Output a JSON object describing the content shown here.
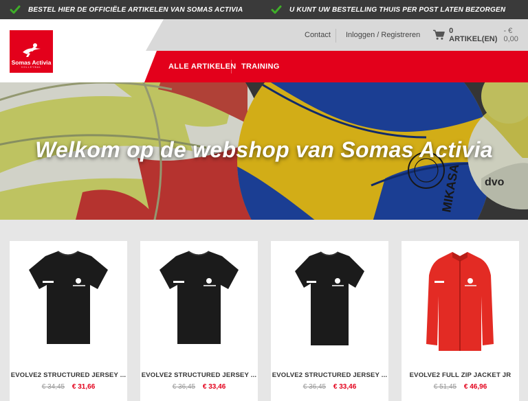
{
  "topbar": {
    "usp_left": "BESTEL HIER DE OFFICIËLE ARTIKELEN VAN SOMAS ACTIVIA",
    "usp_right": "U KUNT UW BESTELLING THUIS PER POST LATEN BEZORGEN",
    "check_icon": "check-icon",
    "check_color": "#3fae29"
  },
  "header": {
    "logo": {
      "name": "Somas Activia",
      "sub": "VOLLEYBAL",
      "color": "#e3001b"
    },
    "utility": {
      "contact": "Contact",
      "login": "Inloggen / Registreren",
      "cart_count": "0 ARTIKEL(EN)",
      "cart_total": "- € 0,00",
      "cart_icon": "cart-icon"
    },
    "nav": {
      "items": [
        "ALLE ARTIKELEN",
        "TRAINING"
      ],
      "accent": "#e3001b"
    }
  },
  "hero": {
    "title": "Welkom op de webshop van Somas Activia"
  },
  "products": [
    {
      "name": "EVOLVE2 STRUCTURED JERSEY ...",
      "old_price": "€ 34,45",
      "price": "€ 31,66",
      "image": "black-tshirt"
    },
    {
      "name": "EVOLVE2 STRUCTURED JERSEY ...",
      "old_price": "€ 36,45",
      "price": "€ 33,46",
      "image": "black-tshirt"
    },
    {
      "name": "EVOLVE2 STRUCTURED JERSEY ...",
      "old_price": "€ 36,45",
      "price": "€ 33,46",
      "image": "black-tshirt"
    },
    {
      "name": "EVOLVE2 FULL ZIP JACKET JR",
      "old_price": "€ 51,45",
      "price": "€ 46,96",
      "image": "red-jacket"
    }
  ]
}
